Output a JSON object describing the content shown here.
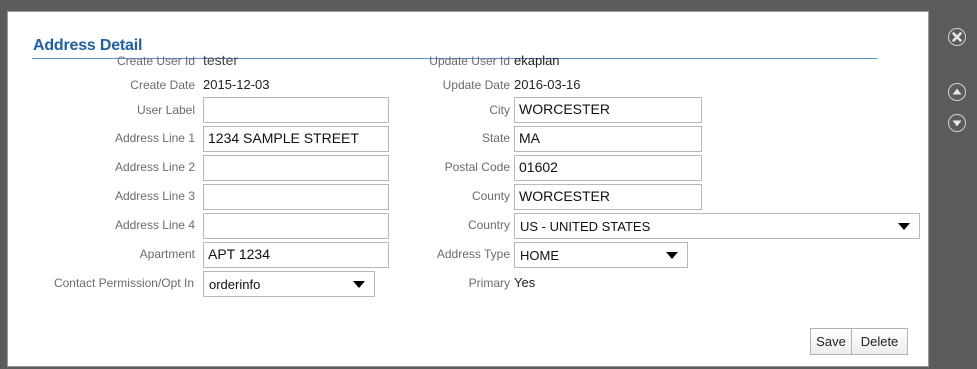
{
  "dialog": {
    "title": "Address Detail"
  },
  "left": {
    "create_user_id_label": "Create User Id",
    "create_user_id": "tester",
    "create_date_label": "Create Date",
    "create_date": "2015-12-03",
    "user_label_label": "User Label",
    "user_label_value": "",
    "address_line1_label": "Address Line 1",
    "address_line1": "1234 SAMPLE STREET",
    "address_line2_label": "Address Line 2",
    "address_line2": "",
    "address_line3_label": "Address Line 3",
    "address_line3": "",
    "address_line4_label": "Address Line 4",
    "address_line4": "",
    "apartment_label": "Apartment",
    "apartment": "APT 1234",
    "contact_permission_label": "Contact Permission/Opt In",
    "contact_permission": "orderinfo"
  },
  "right": {
    "update_user_id_label": "Update User Id",
    "update_user_id": "ekaplan",
    "update_date_label": "Update Date",
    "update_date": "2016-03-16",
    "city_label": "City",
    "city": "WORCESTER",
    "state_label": "State",
    "state": "MA",
    "postal_code_label": "Postal Code",
    "postal_code": "01602",
    "county_label": "County",
    "county": "WORCESTER",
    "country_label": "Country",
    "country": "US - UNITED STATES",
    "address_type_label": "Address Type",
    "address_type": "HOME",
    "primary_label": "Primary",
    "primary": "Yes"
  },
  "buttons": {
    "save": "Save",
    "delete": "Delete"
  },
  "side_icons": [
    "close-icon",
    "scroll-up-icon",
    "scroll-down-icon"
  ],
  "colors": {
    "title": "#1e5fa8",
    "backdrop": "#5b5b5b"
  }
}
